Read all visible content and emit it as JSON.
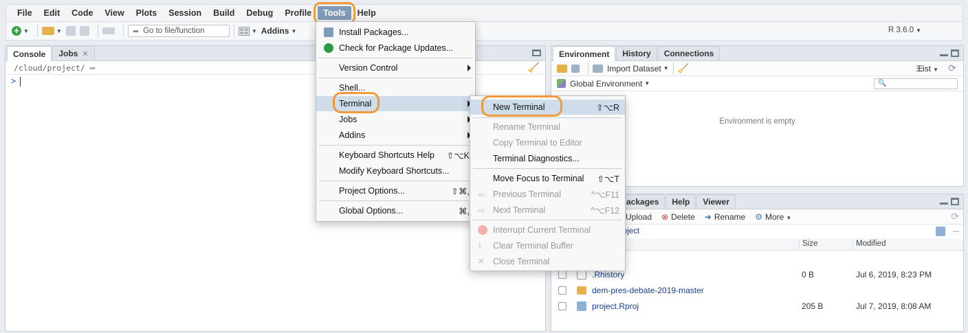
{
  "menubar": {
    "items": [
      "File",
      "Edit",
      "Code",
      "View",
      "Plots",
      "Session",
      "Build",
      "Debug",
      "Profile",
      "Tools",
      "Help"
    ],
    "active": "Tools"
  },
  "toolbar": {
    "goto_placeholder": "Go to file/function",
    "addins_label": "Addins",
    "r_version": "R 3.6.0"
  },
  "left_pane": {
    "tabs": [
      "Console",
      "Jobs"
    ],
    "path": "/cloud/project/",
    "prompt": ">"
  },
  "env_pane": {
    "tabs": [
      "Environment",
      "History",
      "Connections"
    ],
    "import_label": "Import Dataset",
    "list_label": "List",
    "env_label": "Global Environment",
    "empty_text": "Environment is empty"
  },
  "files_pane": {
    "tabs": [
      "ackages",
      "Help",
      "Viewer"
    ],
    "upload_label": "Upload",
    "delete_label": "Delete",
    "rename_label": "Rename",
    "more_label": "More",
    "breadcrumb": "roject",
    "col_size": "Size",
    "col_modified": "Modified",
    "ellipsis": "...",
    "files": [
      {
        "name": ".Rhistory",
        "size": "0 B",
        "modified": "Jul 6, 2019, 8:23 PM"
      },
      {
        "name": "dem-pres-debate-2019-master",
        "size": "",
        "modified": ""
      },
      {
        "name": "project.Rproj",
        "size": "205 B",
        "modified": "Jul 7, 2019, 8:08 AM"
      }
    ]
  },
  "tools_menu": {
    "items": [
      {
        "label": "Install Packages...",
        "shortcut": ""
      },
      {
        "label": "Check for Package Updates...",
        "shortcut": ""
      },
      {
        "label": "Version Control",
        "shortcut": ""
      },
      {
        "label": "Shell...",
        "shortcut": ""
      },
      {
        "label": "Terminal",
        "shortcut": ""
      },
      {
        "label": "Jobs",
        "shortcut": ""
      },
      {
        "label": "Addins",
        "shortcut": ""
      },
      {
        "label": "Keyboard Shortcuts Help",
        "shortcut": "⇧⌥K"
      },
      {
        "label": "Modify Keyboard Shortcuts...",
        "shortcut": ""
      },
      {
        "label": "Project Options...",
        "shortcut": "⇧⌘,"
      },
      {
        "label": "Global Options...",
        "shortcut": "⌘,"
      }
    ]
  },
  "terminal_menu": {
    "items": [
      {
        "label": "New Terminal",
        "shortcut": "⇧⌥R"
      },
      {
        "label": "Rename Terminal",
        "shortcut": ""
      },
      {
        "label": "Copy Terminal to Editor",
        "shortcut": ""
      },
      {
        "label": "Terminal Diagnostics...",
        "shortcut": ""
      },
      {
        "label": "Move Focus to Terminal",
        "shortcut": "⇧⌥T"
      },
      {
        "label": "Previous Terminal",
        "shortcut": "^⌥F11"
      },
      {
        "label": "Next Terminal",
        "shortcut": "^⌥F12"
      },
      {
        "label": "Interrupt Current Terminal",
        "shortcut": ""
      },
      {
        "label": "Clear Terminal Buffer",
        "shortcut": ""
      },
      {
        "label": "Close Terminal",
        "shortcut": ""
      }
    ]
  },
  "colors": {
    "highlight_ring": "#f09a3a",
    "menu_highlight": "#cfdcea",
    "active_menu": "#7f9ab8"
  }
}
